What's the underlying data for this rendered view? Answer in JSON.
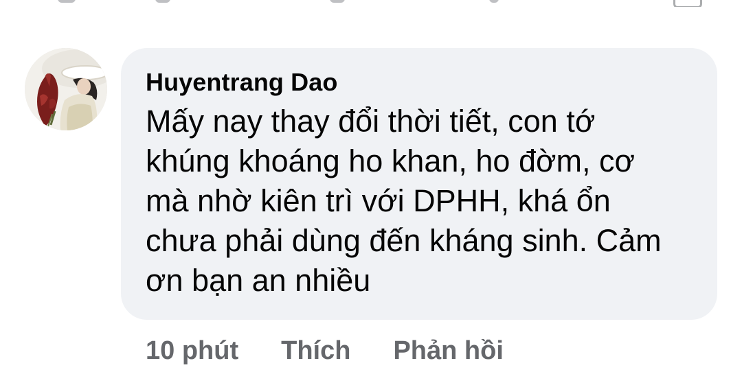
{
  "comment": {
    "author": "Huyentrang Dao",
    "text": "Mấy nay thay đổi thời tiết, con tớ\nkhúng khoáng ho khan, ho đờm, cơ\nmà nhờ kiên trì với DPHH, khá ổn\nchưa phải dùng đến kháng sinh. Cảm\nơn bạn an nhiều",
    "timestamp": "10 phút",
    "actions": {
      "like_label": "Thích",
      "reply_label": "Phản hồi"
    }
  },
  "colors": {
    "bubble_background": "#f0f2f5",
    "author_text": "#050505",
    "body_text": "#050505",
    "action_text": "#65676b"
  },
  "icons": {
    "avatar": "profile-photo"
  }
}
